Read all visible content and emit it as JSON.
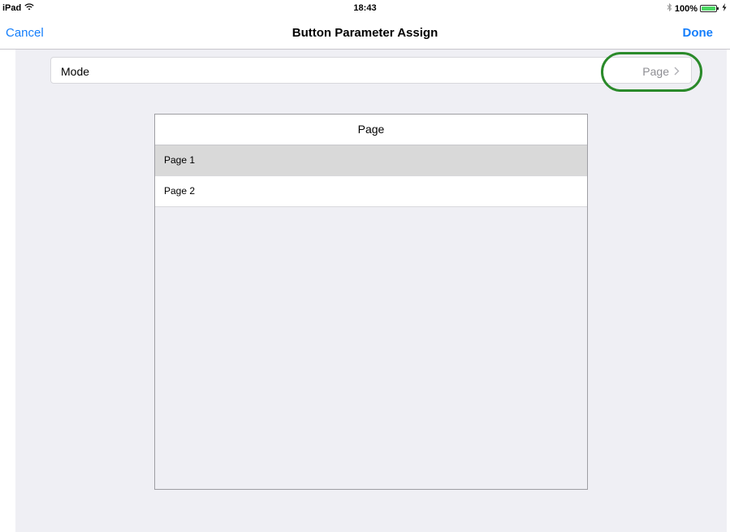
{
  "status_bar": {
    "device": "iPad",
    "wifi_icon": "wifi-icon",
    "time": "18:43",
    "bluetooth_icon": "bluetooth-icon",
    "battery_percent": "100%",
    "battery_level": 1.0,
    "charging_icon": "charging-icon"
  },
  "nav": {
    "cancel_label": "Cancel",
    "title": "Button Parameter Assign",
    "done_label": "Done"
  },
  "mode_row": {
    "label": "Mode",
    "value": "Page",
    "chevron_icon": "chevron-right-icon"
  },
  "picker": {
    "header": "Page",
    "rows": [
      {
        "label": "Page 1",
        "selected": true
      },
      {
        "label": "Page 2",
        "selected": false
      }
    ]
  },
  "colors": {
    "accent": "#147efb",
    "highlight_ring": "#2a8a2a",
    "background": "#efeff4",
    "selected_row": "#d9d9d9"
  }
}
